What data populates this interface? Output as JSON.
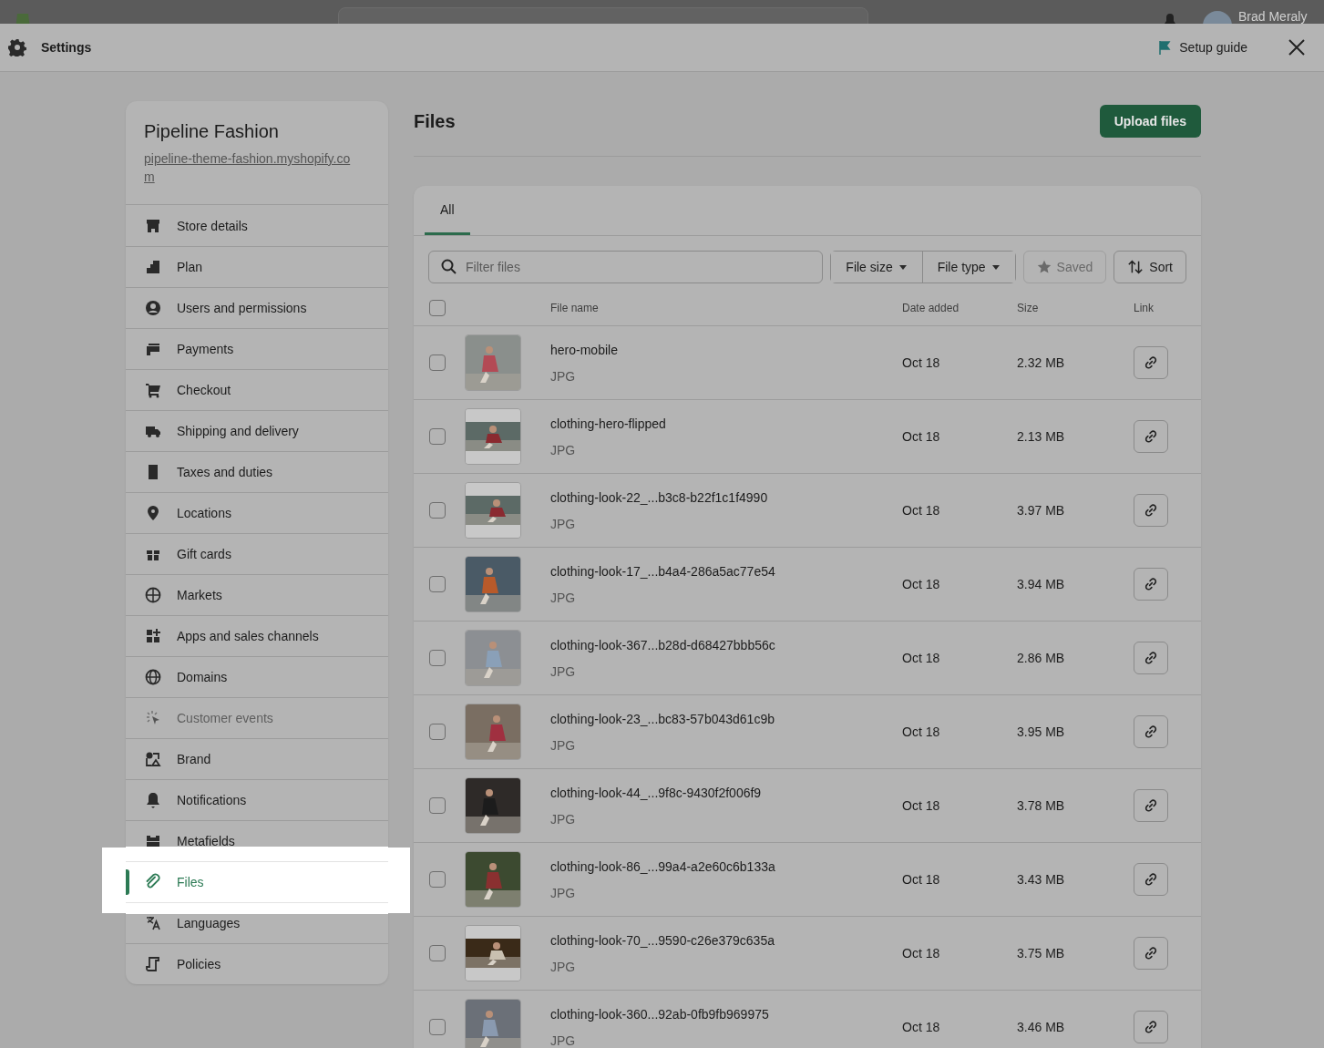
{
  "top_bar": {
    "user_name": "Brad Meraly"
  },
  "header": {
    "title": "Settings",
    "setup_guide": "Setup guide"
  },
  "store": {
    "name": "Pipeline Fashion",
    "url": "pipeline-theme-fashion.myshopify.com"
  },
  "nav": [
    {
      "label": "Store details",
      "selected": false,
      "disabled": false
    },
    {
      "label": "Plan",
      "selected": false,
      "disabled": false
    },
    {
      "label": "Users and permissions",
      "selected": false,
      "disabled": false
    },
    {
      "label": "Payments",
      "selected": false,
      "disabled": false
    },
    {
      "label": "Checkout",
      "selected": false,
      "disabled": false
    },
    {
      "label": "Shipping and delivery",
      "selected": false,
      "disabled": false
    },
    {
      "label": "Taxes and duties",
      "selected": false,
      "disabled": false
    },
    {
      "label": "Locations",
      "selected": false,
      "disabled": false
    },
    {
      "label": "Gift cards",
      "selected": false,
      "disabled": false
    },
    {
      "label": "Markets",
      "selected": false,
      "disabled": false
    },
    {
      "label": "Apps and sales channels",
      "selected": false,
      "disabled": false
    },
    {
      "label": "Domains",
      "selected": false,
      "disabled": false
    },
    {
      "label": "Customer events",
      "selected": false,
      "disabled": true
    },
    {
      "label": "Brand",
      "selected": false,
      "disabled": false
    },
    {
      "label": "Notifications",
      "selected": false,
      "disabled": false
    },
    {
      "label": "Metafields",
      "selected": false,
      "disabled": false
    },
    {
      "label": "Files",
      "selected": true,
      "disabled": false
    },
    {
      "label": "Languages",
      "selected": false,
      "disabled": false
    },
    {
      "label": "Policies",
      "selected": false,
      "disabled": false
    }
  ],
  "page": {
    "title": "Files",
    "upload_button": "Upload files"
  },
  "tabs": [
    {
      "label": "All",
      "selected": true
    }
  ],
  "filter": {
    "placeholder": "Filter files",
    "file_size": "File size",
    "file_type": "File type",
    "saved": "Saved",
    "saved_disabled": true,
    "sort": "Sort"
  },
  "table": {
    "columns": [
      "File name",
      "Date added",
      "Size",
      "Link"
    ],
    "all_checked": false,
    "rows": [
      {
        "name": "hero-mobile",
        "type": "JPG",
        "date": "Oct 18",
        "size": "2.32 MB",
        "checked": false
      },
      {
        "name": "clothing-hero-flipped",
        "type": "JPG",
        "date": "Oct 18",
        "size": "2.13 MB",
        "checked": false
      },
      {
        "name": "clothing-look-22_...b3c8-b22f1c1f4990",
        "type": "JPG",
        "date": "Oct 18",
        "size": "3.97 MB",
        "checked": false
      },
      {
        "name": "clothing-look-17_...b4a4-286a5ac77e54",
        "type": "JPG",
        "date": "Oct 18",
        "size": "3.94 MB",
        "checked": false
      },
      {
        "name": "clothing-look-367...b28d-d68427bbb56c",
        "type": "JPG",
        "date": "Oct 18",
        "size": "2.86 MB",
        "checked": false
      },
      {
        "name": "clothing-look-23_...bc83-57b043d61c9b",
        "type": "JPG",
        "date": "Oct 18",
        "size": "3.95 MB",
        "checked": false
      },
      {
        "name": "clothing-look-44_...9f8c-9430f2f006f9",
        "type": "JPG",
        "date": "Oct 18",
        "size": "3.78 MB",
        "checked": false
      },
      {
        "name": "clothing-look-86_...99a4-a2e60c6b133a",
        "type": "JPG",
        "date": "Oct 18",
        "size": "3.43 MB",
        "checked": false
      },
      {
        "name": "clothing-look-70_...9590-c26e379c635a",
        "type": "JPG",
        "date": "Oct 18",
        "size": "3.75 MB",
        "checked": false
      },
      {
        "name": "clothing-look-360...92ab-0fb9fb969975",
        "type": "JPG",
        "date": "Oct 18",
        "size": "3.46 MB",
        "checked": false
      }
    ]
  }
}
